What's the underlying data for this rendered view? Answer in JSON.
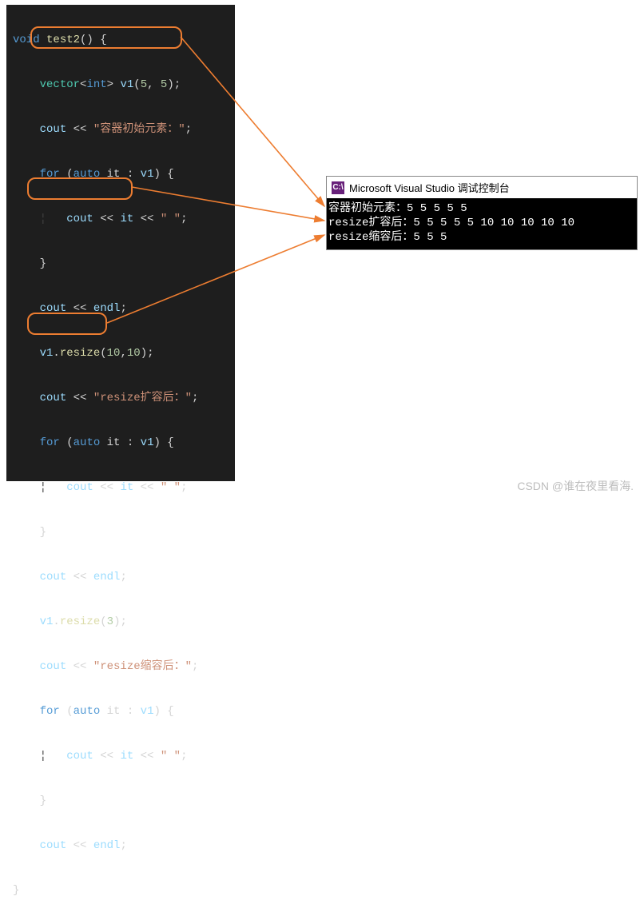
{
  "code": {
    "l1_kw": "void",
    "l1_fn": "test2",
    "l1_rest": "() {",
    "l2a": "vector",
    "l2b": "<",
    "l2c": "int",
    "l2d": "> ",
    "l2e": "v1",
    "l2f": "(",
    "l2g": "5",
    "l2h": ", ",
    "l2i": "5",
    "l2j": ");",
    "l3a": "cout",
    "l3b": " << ",
    "l3c": "\"容器初始元素：\"",
    "l3d": ";",
    "l4a": "for",
    "l4b": " (",
    "l4c": "auto",
    "l4d": " it : ",
    "l4e": "v1",
    "l4f": ") {",
    "l5a": "cout",
    "l5b": " << ",
    "l5c": "it",
    "l5d": " << ",
    "l5e": "\" \"",
    "l5f": ";",
    "l6": "}",
    "l7a": "cout",
    "l7b": " << ",
    "l7c": "endl",
    "l7d": ";",
    "l8a": "v1",
    "l8b": ".",
    "l8c": "resize",
    "l8d": "(",
    "l8e": "10",
    "l8f": ",",
    "l8g": "10",
    "l8h": ");",
    "l9a": "cout",
    "l9b": " << ",
    "l9c": "\"resize扩容后：\"",
    "l9d": ";",
    "l10a": "for",
    "l10b": " (",
    "l10c": "auto",
    "l10d": " it : ",
    "l10e": "v1",
    "l10f": ") {",
    "l11a": "cout",
    "l11b": " << ",
    "l11c": "it",
    "l11d": " << ",
    "l11e": "\" \"",
    "l11f": ";",
    "l12": "}",
    "l13a": "cout",
    "l13b": " << ",
    "l13c": "endl",
    "l13d": ";",
    "l14a": "v1",
    "l14b": ".",
    "l14c": "resize",
    "l14d": "(",
    "l14e": "3",
    "l14f": ");",
    "l15a": "cout",
    "l15b": " << ",
    "l15c": "\"resize缩容后：\"",
    "l15d": ";",
    "l16a": "for",
    "l16b": " (",
    "l16c": "auto",
    "l16d": " it : ",
    "l16e": "v1",
    "l16f": ") {",
    "l17a": "cout",
    "l17b": " << ",
    "l17c": "it",
    "l17d": " << ",
    "l17e": "\" \"",
    "l17f": ";",
    "l18": "}",
    "l19a": "cout",
    "l19b": " << ",
    "l19c": "endl",
    "l19d": ";",
    "l20": "}"
  },
  "console": {
    "title": "Microsoft Visual Studio 调试控制台",
    "icon": "C:\\",
    "line1": "容器初始元素：5 5 5 5 5",
    "line2": "resize扩容后：5 5 5 5 5 10 10 10 10 10",
    "line3": "resize缩容后：5 5 5"
  },
  "watermark": "CSDN @谁在夜里看海."
}
